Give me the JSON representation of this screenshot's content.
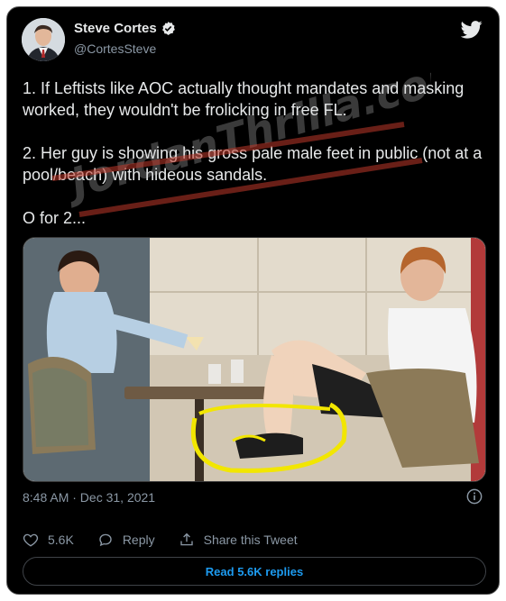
{
  "author": {
    "name": "Steve Cortes",
    "handle": "@CortesSteve",
    "verified": true
  },
  "tweet": {
    "paragraphs": [
      "1. If Leftists like AOC actually thought mandates and masking worked, they wouldn't be frolicking in free FL.",
      "2. Her guy is showing his gross pale male feet in public (not at a pool/beach) with hideous sandals.",
      "O for 2..."
    ],
    "timestamp": "8:48 AM · Dec 31, 2021"
  },
  "watermark": {
    "text": "JordanThrilla.com"
  },
  "actions": {
    "like_count": "5.6K",
    "reply_label": "Reply",
    "share_label": "Share this Tweet"
  },
  "replies_button": {
    "label": "Read 5.6K replies"
  },
  "icons": {
    "brand": "twitter-bird-icon",
    "verified": "verified-badge-icon",
    "info": "info-icon",
    "like": "heart-icon",
    "reply": "speech-bubble-icon",
    "share": "share-upload-icon"
  },
  "colors": {
    "background": "#000000",
    "text": "#e7e9ea",
    "secondary_text": "#8b98a5",
    "accent": "#1d9bf0",
    "highlight_circle": "#f2e600"
  }
}
